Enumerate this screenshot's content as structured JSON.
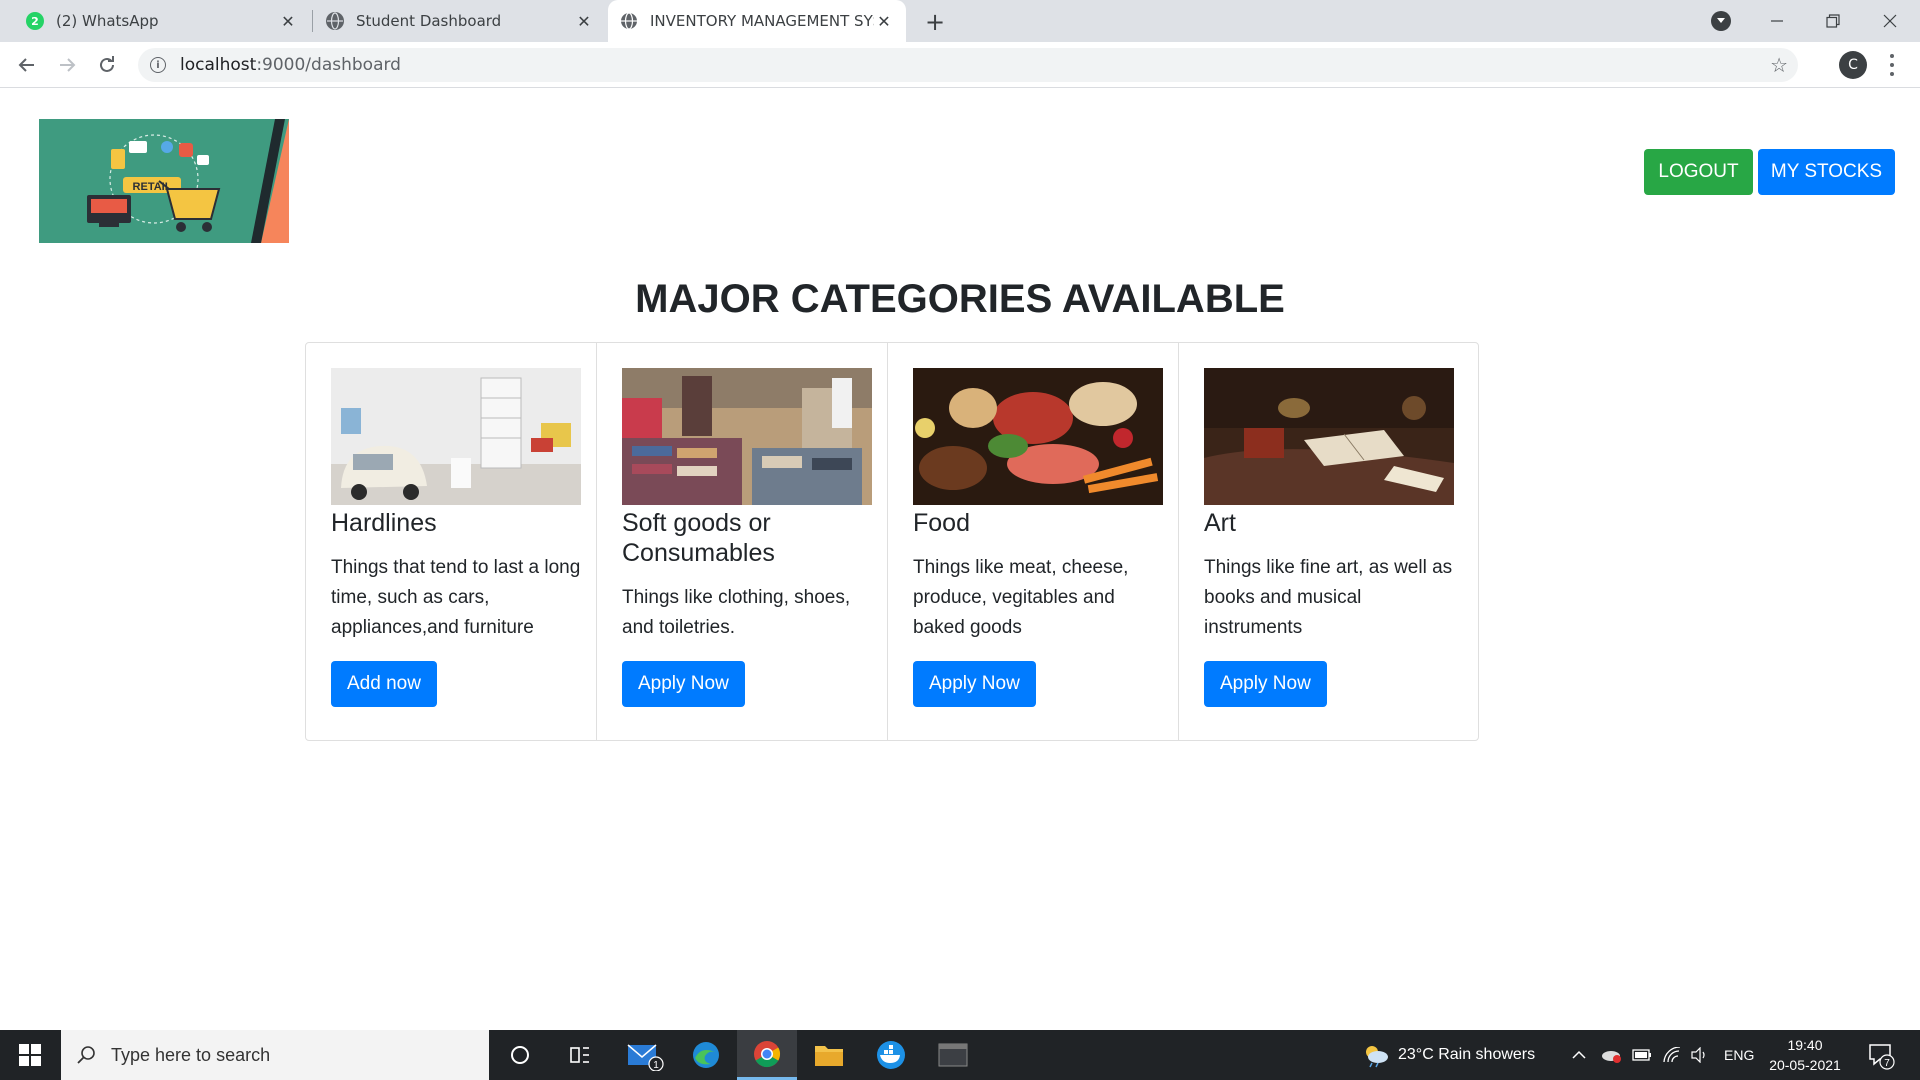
{
  "browser": {
    "tabs": [
      {
        "title": "(2) WhatsApp",
        "favicon_badge": "2"
      },
      {
        "title": "Student Dashboard"
      },
      {
        "title": "INVENTORY MANAGEMENT SYST"
      }
    ],
    "url_host": "localhost",
    "url_rest": ":9000/dashboard",
    "profile_initial": "C"
  },
  "header": {
    "logo_label": "RETAIL",
    "logout_label": "LOGOUT",
    "stocks_label": "MY STOCKS"
  },
  "main": {
    "heading": "MAJOR CATEGORIES AVAILABLE",
    "cards": [
      {
        "title": "Hardlines",
        "text": "Things that tend to last a long time, such as cars, appliances,and furniture",
        "button": "Add now"
      },
      {
        "title": "Soft goods or Consumables",
        "text": "Things like clothing, shoes, and toiletries.",
        "button": "Apply Now"
      },
      {
        "title": "Food",
        "text": "Things like meat, cheese, produce, vegitables and baked goods",
        "button": "Apply Now"
      },
      {
        "title": "Art",
        "text": "Things like fine art, as well as books and musical instruments",
        "button": "Apply Now"
      }
    ]
  },
  "taskbar": {
    "search_placeholder": "Type here to search",
    "weather": "23°C  Rain showers",
    "lang": "ENG",
    "time": "19:40",
    "date": "20-05-2021",
    "mail_badge": "1",
    "notif_count": "7"
  },
  "colors": {
    "primary": "#007bff",
    "success": "#28a745",
    "taskbar": "#202326"
  }
}
